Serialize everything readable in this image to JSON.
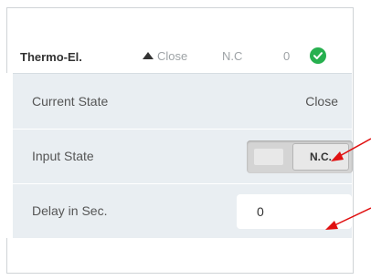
{
  "header": {
    "title": "Thermo-El.",
    "state_text": "Close",
    "mode_text": "N.C",
    "value_text": "0",
    "status_color": "#27b04f"
  },
  "rows": [
    {
      "label": "Current State",
      "value": "Close"
    },
    {
      "label": "Input State",
      "toggle_label": "N.C."
    },
    {
      "label": "Delay in Sec.",
      "input_value": "0"
    }
  ],
  "icons": {
    "state_arrow": "triangle-up-icon",
    "status": "check-circle-icon"
  },
  "colors": {
    "panel_bg": "#e9eef2",
    "annotation_arrow": "#e01010"
  }
}
